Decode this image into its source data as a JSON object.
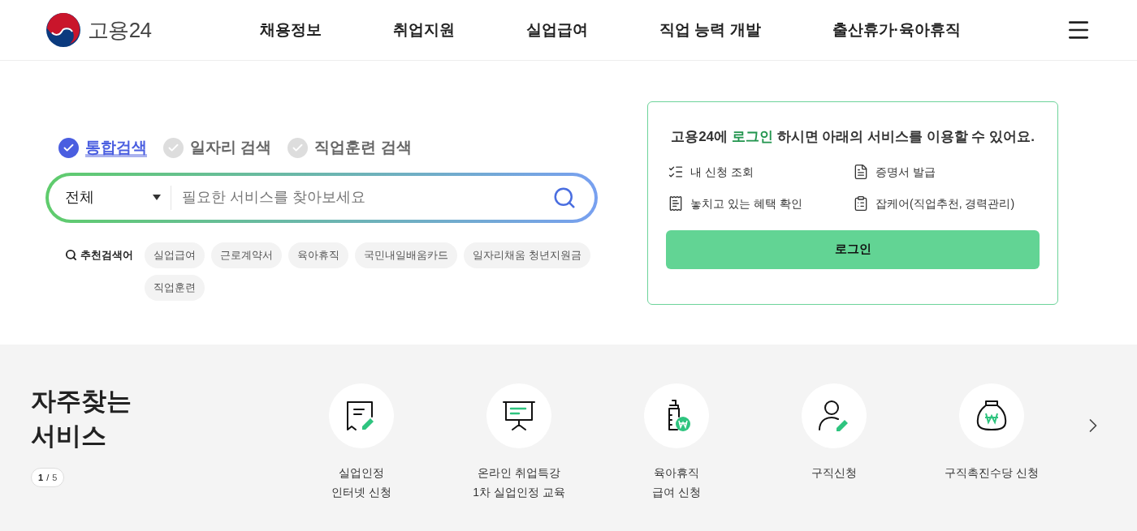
{
  "header": {
    "logo_text": "고용24",
    "nav": [
      "채용정보",
      "취업지원",
      "실업급여",
      "직업 능력 개발",
      "출산휴가·육아휴직"
    ]
  },
  "search": {
    "tabs": [
      {
        "label": "통합검색",
        "selected": true
      },
      {
        "label": "일자리 검색",
        "selected": false
      },
      {
        "label": "직업훈련 검색",
        "selected": false
      }
    ],
    "category": "전체",
    "placeholder": "필요한 서비스를 찾아보세요",
    "recommended_label": "추천검색어",
    "keywords": [
      "실업급여",
      "근로계약서",
      "육아휴직",
      "국민내일배움카드",
      "일자리채움 청년지원금",
      "직업훈련"
    ]
  },
  "login_card": {
    "title_before": "고용24에",
    "title_highlight": "로그인",
    "title_after": "하시면 아래의 서비스를 이용할 수 있어요.",
    "features": [
      {
        "kind": "list",
        "label": "내 신청 조회"
      },
      {
        "kind": "certificate",
        "label": "증명서 발급"
      },
      {
        "kind": "benefit",
        "label": "놓치고 있는 혜택 확인"
      },
      {
        "kind": "jobcare",
        "label": "잡케어(직업추천, 경력관리)"
      }
    ],
    "button": "로그인"
  },
  "frequent": {
    "title_lines": [
      "자주찾는",
      "서비스"
    ],
    "page_current": "1",
    "page_separator": "/",
    "page_total": "5",
    "services": [
      {
        "kind": "receipt",
        "lines": [
          "실업인정",
          "인터넷 신청"
        ]
      },
      {
        "kind": "presentation",
        "lines": [
          "온라인 취업특강",
          "1차 실업인정 교육"
        ]
      },
      {
        "kind": "bottle",
        "lines": [
          "육아휴직",
          "급여 신청"
        ]
      },
      {
        "kind": "person",
        "lines": [
          "구직신청"
        ]
      },
      {
        "kind": "moneybag",
        "lines": [
          "구직촉진수당 신청"
        ]
      }
    ]
  }
}
